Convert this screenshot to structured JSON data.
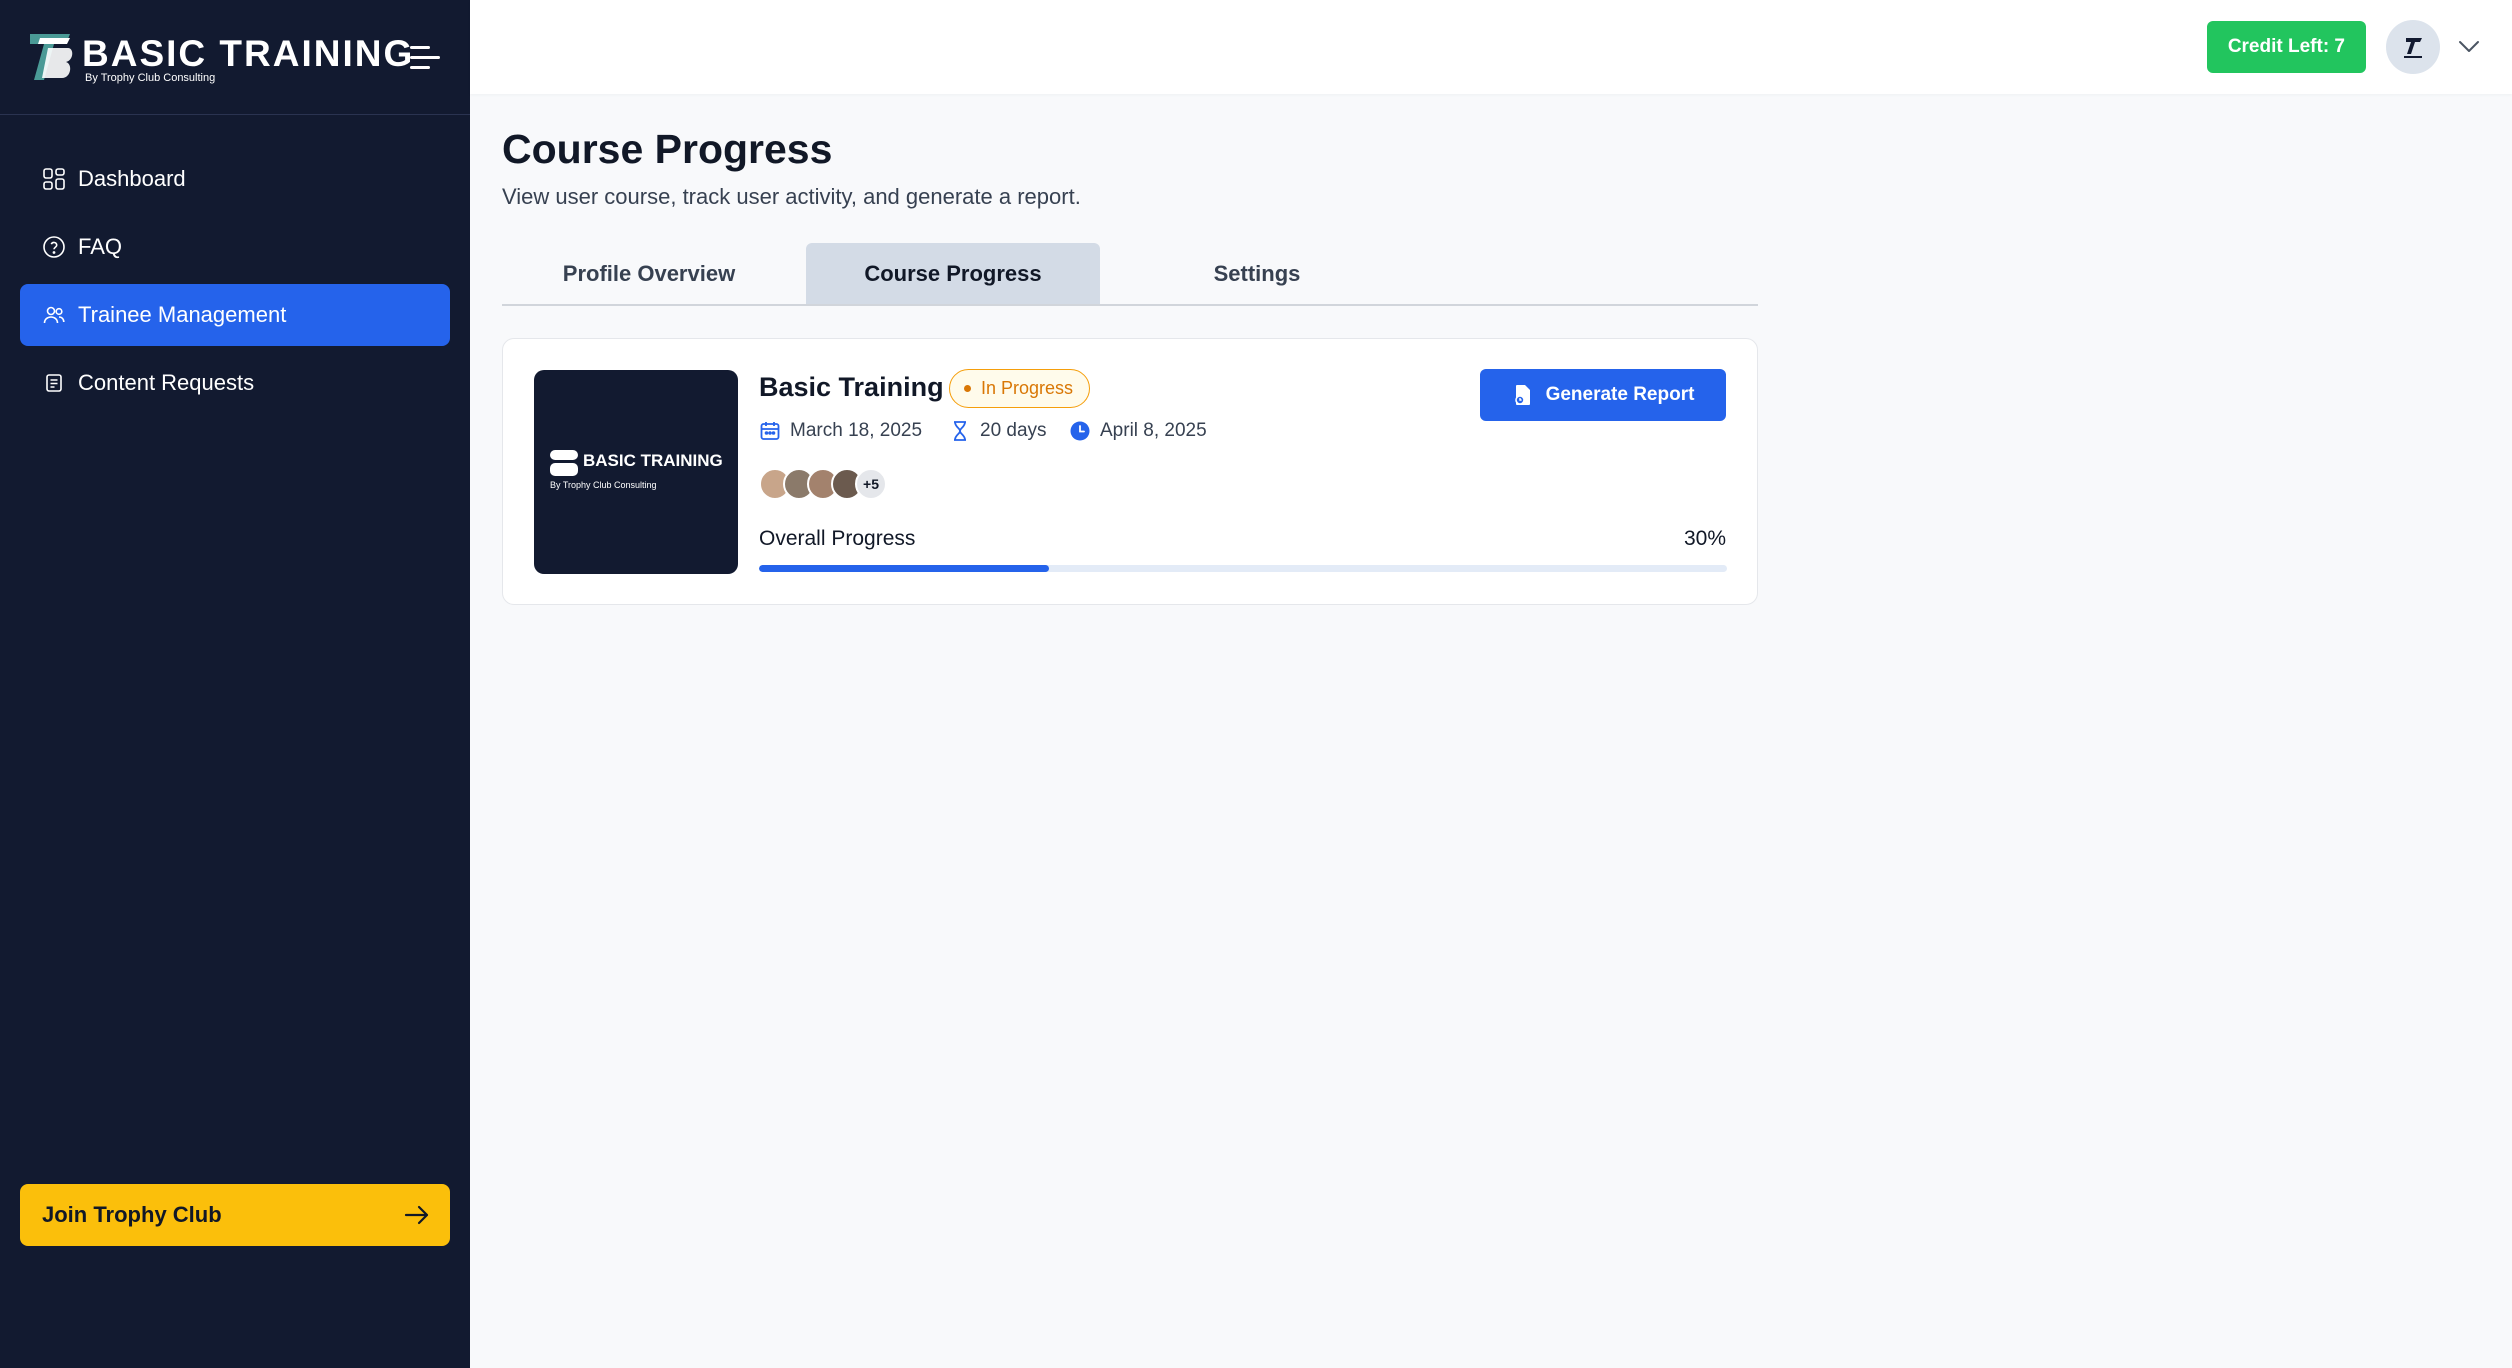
{
  "brand": {
    "title": "BASIC TRAINING",
    "subtitle": "By Trophy Club Consulting"
  },
  "sidebar": {
    "items": [
      {
        "label": "Dashboard",
        "icon": "dashboard-grid-icon",
        "active": false
      },
      {
        "label": "FAQ",
        "icon": "question-circle-icon",
        "active": false
      },
      {
        "label": "Trainee Management",
        "icon": "users-icon",
        "active": true
      },
      {
        "label": "Content Requests",
        "icon": "document-list-icon",
        "active": false
      }
    ],
    "join_button": {
      "label": "Join Trophy Club",
      "icon": "arrow-right-icon"
    }
  },
  "topbar": {
    "credit_label": "Credit Left: 7",
    "avatar_icon": "brand-logo-avatar",
    "menu_icon": "chevron-down-icon"
  },
  "main": {
    "title": "Course Progress",
    "subtitle": "View user course, track user activity, and generate a report.",
    "tabs": [
      {
        "label": "Profile Overview",
        "active": false
      },
      {
        "label": "Course Progress",
        "active": true
      },
      {
        "label": "Settings",
        "active": false
      }
    ]
  },
  "course": {
    "thumbnail_title": "BASIC TRAINING",
    "thumbnail_subtitle": "By Trophy Club Consulting",
    "title": "Basic Training",
    "status": "In Progress",
    "start_date": "March 18, 2025",
    "duration": "20 days",
    "end_date": "April 8, 2025",
    "extra_participants": "+5",
    "progress_label": "Overall Progress",
    "progress_text": "30%",
    "progress_value": 0.3,
    "report_button": "Generate Report"
  },
  "colors": {
    "sidebar_bg": "#121a30",
    "accent": "#2563eb",
    "credit": "#22c55e",
    "join": "#fbbf0b",
    "status": "#d97706"
  }
}
